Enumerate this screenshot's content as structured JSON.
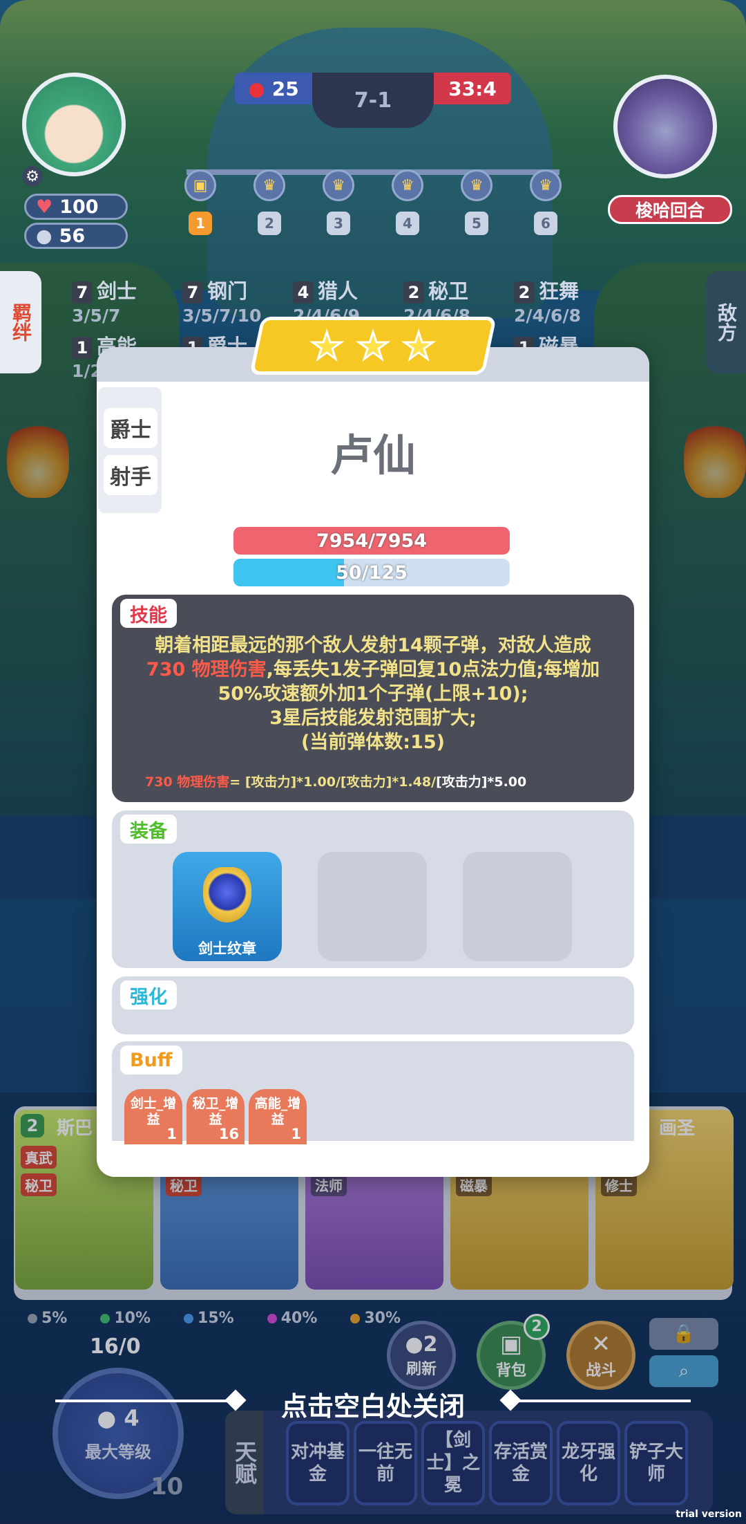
{
  "hud": {
    "player_hp": "100",
    "player_gold": "56",
    "left_score": "25",
    "stage": "7-1",
    "right_score": "33:4",
    "opponent_name": "梭哈回合",
    "rounds": [
      "1",
      "2",
      "3",
      "4",
      "5",
      "6"
    ],
    "active_round": "1"
  },
  "side_tabs": {
    "left": "羁绊",
    "right": "敌方"
  },
  "traits": [
    {
      "count": "7",
      "name": "剑士",
      "tiers": "3/5/7"
    },
    {
      "count": "7",
      "name": "钢门",
      "tiers": "3/5/7/10"
    },
    {
      "count": "4",
      "name": "猎人",
      "tiers": "2/4/6/9"
    },
    {
      "count": "2",
      "name": "秘卫",
      "tiers": "2/4/6/8"
    },
    {
      "count": "2",
      "name": "狂舞",
      "tiers": "2/4/6/8"
    },
    {
      "count": "1",
      "name": "高能",
      "tiers": "1/2"
    },
    {
      "count": "1",
      "name": "爵士",
      "tiers": ""
    },
    {
      "count": "1",
      "name": "磁暴",
      "tiers": ""
    }
  ],
  "modal": {
    "stars": 3,
    "origins": [
      "爵士",
      "射手"
    ],
    "hero_name": "卢仙",
    "hp_text": "7954/7954",
    "hp_fraction": 1.0,
    "mana_text": "50/125",
    "mana_fraction": 0.4,
    "skill": {
      "label": "技能",
      "line1": "朝着相距最远的那个敌人发射14颗子弹，对敌人造成",
      "line2_highlight": "730 物理伤害",
      "line2_rest": ",每丢失1发子弹回复10点法力值;每增加",
      "line3": "50%攻速额外加1个子弹(上限+10);",
      "line4": "3星后技能发射范围扩大;",
      "line5": "(当前弹体数:15)",
      "formula_highlight": "730 物理伤害",
      "formula_mid": "= [攻击力]*1.00/[攻击力]*1.48/",
      "formula_end": "[攻击力]*5.00"
    },
    "equip": {
      "label": "装备",
      "items": [
        {
          "name": "剑士纹章"
        }
      ]
    },
    "enhance": {
      "label": "强化"
    },
    "buff": {
      "label": "Buff",
      "items": [
        {
          "name": "剑士_增益",
          "count": "1"
        },
        {
          "name": "秘卫_增益",
          "count": "16"
        },
        {
          "name": "高能_增益",
          "count": "1"
        }
      ]
    }
  },
  "shop": {
    "cards": [
      {
        "cost": "2",
        "name": "斯巴",
        "tags": [
          "真武",
          "秘卫"
        ]
      },
      {
        "cost": "",
        "name": "",
        "tags": [
          "秘卫"
        ]
      },
      {
        "cost": "",
        "name": "",
        "tags": [
          "法师"
        ]
      },
      {
        "cost": "",
        "name": "",
        "tags": [
          "磁暴"
        ]
      },
      {
        "cost": "",
        "name": "画圣",
        "tags": [
          "修士"
        ]
      }
    ],
    "odds": [
      "5%",
      "10%",
      "15%",
      "40%",
      "30%"
    ],
    "exp": "16/0",
    "level_cost": "4",
    "level_label": "最大等级",
    "level": "10",
    "refresh_cost": "2",
    "refresh_label": "刷新",
    "bag_label": "背包",
    "bag_badge": "2",
    "battle_label": "战斗"
  },
  "talents": {
    "label": "天赋",
    "items": [
      "对冲基金",
      "一往无前",
      "【剑士】之冕",
      "存活赏金",
      "龙牙强化",
      "铲子大师"
    ]
  },
  "close_hint": "点击空白处关闭",
  "watermark": "trial version"
}
